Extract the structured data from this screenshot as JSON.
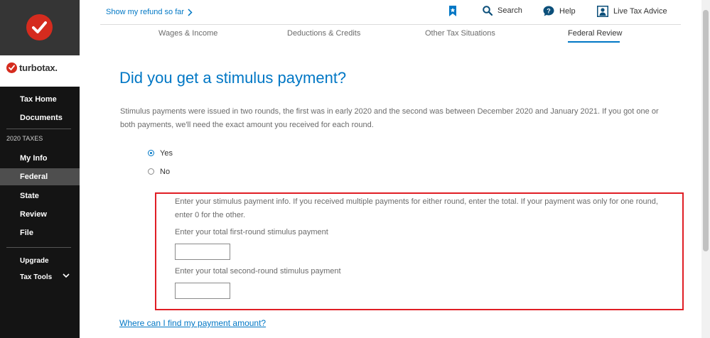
{
  "sidebar": {
    "brand": "turbotax.",
    "items": [
      {
        "label": "Tax Home"
      },
      {
        "label": "Documents"
      },
      {
        "label": "My Info"
      },
      {
        "label": "Federal"
      },
      {
        "label": "State"
      },
      {
        "label": "Review"
      },
      {
        "label": "File"
      },
      {
        "label": "Upgrade"
      },
      {
        "label": "Tax Tools"
      }
    ],
    "section_label": "2020 TAXES",
    "active_item": "Federal"
  },
  "topbar": {
    "refund_link": "Show my refund so far",
    "search_label": "Search",
    "help_label": "Help",
    "live_advice_label": "Live Tax Advice"
  },
  "tabs": [
    {
      "label": "Wages & Income"
    },
    {
      "label": "Deductions & Credits"
    },
    {
      "label": "Other Tax Situations"
    },
    {
      "label": "Federal Review"
    }
  ],
  "main": {
    "title": "Did you get a stimulus payment?",
    "description": "Stimulus payments were issued in two rounds, the first was in early 2020 and the second was between December 2020 and January 2021. If you got one or both payments, we'll need the exact amount you received for each round.",
    "options": [
      {
        "label": "Yes",
        "selected": true
      },
      {
        "label": "No",
        "selected": false
      }
    ],
    "info_text": "Enter your stimulus payment info. If you received multiple payments for either round, enter the total. If your payment was only for one round, enter 0 for the other.",
    "first_round_label": "Enter your total first-round stimulus payment",
    "first_round_value": "",
    "second_round_label": "Enter your total second-round stimulus payment",
    "second_round_value": "",
    "help_link": "Where can I find my payment amount?"
  },
  "colors": {
    "brand_red": "#d52b1e",
    "link_blue": "#0077c5",
    "highlight_red": "#e01e25",
    "sidebar_dark": "#141414"
  },
  "icons": [
    "checkmark-logo-icon",
    "chevron-right-icon",
    "bookmark-icon",
    "search-icon",
    "help-icon",
    "live-advice-icon",
    "chevron-down-icon"
  ]
}
